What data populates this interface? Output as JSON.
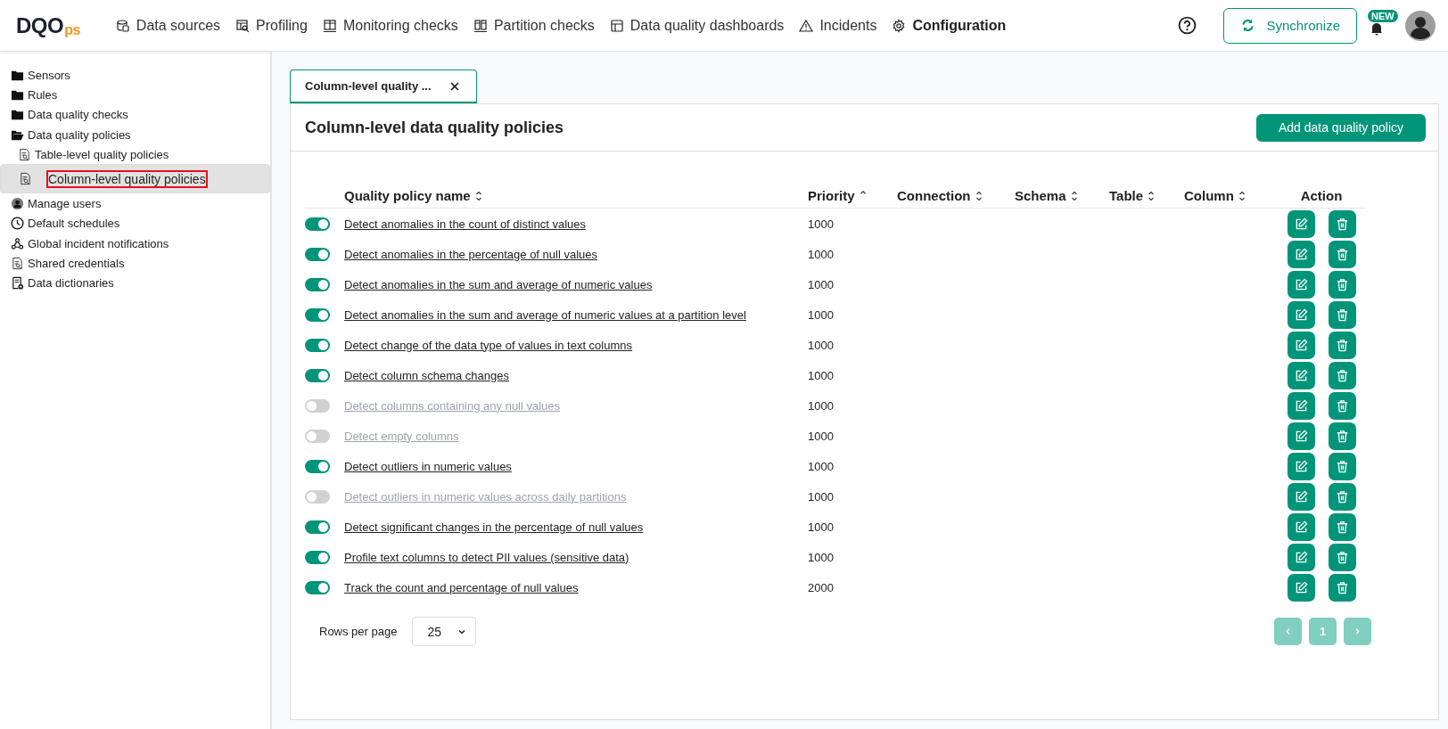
{
  "logo": {
    "main": "DQO",
    "suffix": "ps"
  },
  "nav": [
    {
      "label": "Data sources",
      "kind": "database",
      "selected": false
    },
    {
      "label": "Profiling",
      "kind": "profiling",
      "selected": false
    },
    {
      "label": "Monitoring checks",
      "kind": "monitor",
      "selected": false
    },
    {
      "label": "Partition checks",
      "kind": "partition",
      "selected": false
    },
    {
      "label": "Data quality dashboards",
      "kind": "dashboard",
      "selected": false
    },
    {
      "label": "Incidents",
      "kind": "warning",
      "selected": false
    },
    {
      "label": "Configuration",
      "kind": "gear",
      "selected": true
    }
  ],
  "header_actions": {
    "sync_button": "Synchronize",
    "badge": "NEW"
  },
  "sidebar": {
    "items": [
      {
        "label": "Sensors",
        "kind": "folder",
        "selected": false
      },
      {
        "label": "Rules",
        "kind": "folder",
        "selected": false
      },
      {
        "label": "Data quality checks",
        "kind": "folder",
        "selected": false
      },
      {
        "label": "Data quality policies",
        "kind": "folder",
        "expanded": true,
        "selected": false,
        "children": [
          {
            "label": "Table-level quality policies",
            "kind": "doc",
            "selected": false
          },
          {
            "label": "Column-level quality policies",
            "kind": "doc",
            "selected": true
          }
        ]
      },
      {
        "label": "Manage users",
        "kind": "user",
        "selected": false
      },
      {
        "label": "Default schedules",
        "kind": "clock",
        "selected": false
      },
      {
        "label": "Global incident notifications",
        "kind": "webhook",
        "selected": false
      },
      {
        "label": "Shared credentials",
        "kind": "doc",
        "selected": false
      },
      {
        "label": "Data dictionaries",
        "kind": "dict",
        "selected": false
      }
    ]
  },
  "tabs": [
    {
      "label": "Column-level quality ...",
      "selected": true
    }
  ],
  "panel": {
    "title": "Column-level data quality policies",
    "add_button": "Add data quality policy"
  },
  "table": {
    "columns": [
      {
        "label": "Quality policy name",
        "sortable": true,
        "sorted": false
      },
      {
        "label": "Priority",
        "sortable": true,
        "sorted": true
      },
      {
        "label": "Connection",
        "sortable": true,
        "sorted": false
      },
      {
        "label": "Schema",
        "sortable": true,
        "sorted": false
      },
      {
        "label": "Table",
        "sortable": true,
        "sorted": false
      },
      {
        "label": "Column",
        "sortable": true,
        "sorted": false
      },
      {
        "label": "Action",
        "sortable": false
      }
    ],
    "rows": [
      {
        "enabled": true,
        "name": "Detect anomalies in the count of distinct values",
        "priority": "1000"
      },
      {
        "enabled": true,
        "name": "Detect anomalies in the percentage of null values",
        "priority": "1000"
      },
      {
        "enabled": true,
        "name": "Detect anomalies in the sum and average of numeric values",
        "priority": "1000"
      },
      {
        "enabled": true,
        "name": "Detect anomalies in the sum and average of numeric values at a partition level",
        "priority": "1000"
      },
      {
        "enabled": true,
        "name": "Detect change of the data type of values in text columns",
        "priority": "1000"
      },
      {
        "enabled": true,
        "name": "Detect column schema changes",
        "priority": "1000"
      },
      {
        "enabled": false,
        "name": "Detect columns containing any null values",
        "priority": "1000"
      },
      {
        "enabled": false,
        "name": "Detect empty columns",
        "priority": "1000"
      },
      {
        "enabled": true,
        "name": "Detect outliers in numeric values",
        "priority": "1000"
      },
      {
        "enabled": false,
        "name": "Detect outliers in numeric values across daily partitions",
        "priority": "1000"
      },
      {
        "enabled": true,
        "name": "Detect significant changes in the percentage of null values",
        "priority": "1000"
      },
      {
        "enabled": true,
        "name": "Profile text columns to detect PII values (sensitive data)",
        "priority": "1000"
      },
      {
        "enabled": true,
        "name": "Track the count and percentage of null values",
        "priority": "2000"
      }
    ]
  },
  "pagination": {
    "rows_per_page_label": "Rows per page",
    "rows_per_page": "25",
    "pages": [
      "1"
    ]
  }
}
